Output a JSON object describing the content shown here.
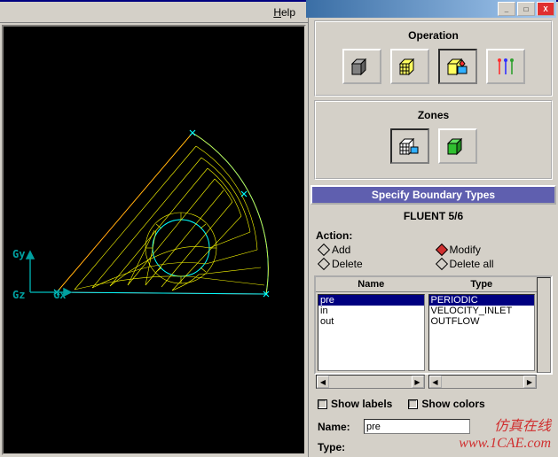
{
  "menu": {
    "help": "Help"
  },
  "window_controls": {
    "min": "_",
    "max": "□",
    "close": "X"
  },
  "right": {
    "operation_title": "Operation",
    "zones_title": "Zones",
    "panel_header": "Specify Boundary Types",
    "subtitle": "FLUENT 5/6",
    "action_label": "Action:",
    "actions": {
      "add": "Add",
      "modify": "Modify",
      "delete": "Delete",
      "deleteall": "Delete all"
    },
    "columns": {
      "name": "Name",
      "type": "Type"
    },
    "names": [
      "pre",
      "in",
      "out"
    ],
    "types": [
      "PERIODIC",
      "VELOCITY_INLET",
      "OUTFLOW"
    ],
    "show_labels": "Show labels",
    "show_colors": "Show colors",
    "name_label": "Name:",
    "name_value": "pre",
    "type_label": "Type:"
  },
  "axes": {
    "gy": "Gy",
    "gz": "Gz",
    "gx": "Gx"
  },
  "watermark": {
    "line1": "仿真在线",
    "line2": "www.1CAE.com"
  }
}
